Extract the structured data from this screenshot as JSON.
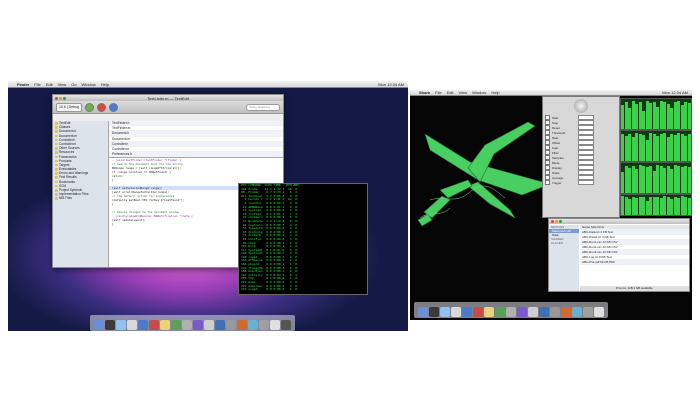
{
  "left_screen": {
    "menubar": {
      "apple": "",
      "items": [
        "Finder",
        "File",
        "Edit",
        "View",
        "Go",
        "Window",
        "Help"
      ],
      "clock": "Mon 12:34 AM"
    },
    "xcode_window": {
      "title": "TextLister.m — TextEdit",
      "toolbar": {
        "scheme": "10.6 | Debug",
        "buttons": [
          "Build and Go",
          "Tasks",
          "Info"
        ],
        "search_placeholder": "String Matching"
      },
      "sidebar_items": [
        "TextEdit",
        "Classes",
        "Document.h",
        "Document.m",
        "Controller.h",
        "Controller.m",
        "Other Sources",
        "Resources",
        "Frameworks",
        "Products",
        "Targets",
        "Executables",
        "Errors and Warnings",
        "Find Results",
        "Bookmarks",
        "SCM",
        "Project Symbols",
        "Implementation Files",
        "NIB Files"
      ],
      "file_list": [
        "TextFinder.h",
        "TextFinder.m",
        "Document.h",
        "Document.m",
        "Controller.h",
        "Controller.m",
        "Preferences.h",
        "Preferences.m"
      ],
      "editor_lines": [
        "- (void)textFinder:(TextFinder *)finder {",
        "    // Search the document text for the string",
        "    NSRange range = [self rangeOfString:str];",
        "    if (range.location == NSNotFound) {",
        "        return;",
        "    }",
        "",
        "    [self setSelectedRange:range];",
        "    [self scrollRangeToVisible:range];",
        "    // The default action for preferences",
        "    [defaults setBool:YES forKey:@\"LastFound\"];",
        "}",
        "",
        "// Resize changes to the document window",
        "- (void)windowDidResize:(NSNotification *)note {",
        "    [self updateLayout];",
        "}"
      ]
    },
    "terminal": {
      "lines": [
        "PID COMMAND  %CPU TIME   #TH #WQ",
        "142 Xcode    12.3 4:12.3  18  2",
        "98  Finder    0.7 0:23.1   8  1",
        "211 Terminal  3.2 0:05.8   4  0",
        "  0 kernel_t  5.1 9:41.0  62  0",
        "  1 launchd   0.0 0:02.4   3  0",
        " 12 mDNSResp  0.0 0:01.1   9  0",
        " 15 syslogd   0.0 0:00.8   4  0",
        " 18 configd   0.1 0:01.7   7  1",
        " 22 coreserv  0.0 0:00.9   5  0",
        " 31 WindowSe  1.4 1:12.6   6  0",
        " 44 loginwin  0.0 0:00.3   2  0",
        " 57 fseventd  0.0 0:00.5   4  0",
        " 63 distnote  0.0 0:00.2   2  0",
        " 75 diskarb   0.0 0:00.4   3  0",
        " 81 notifyd   0.0 0:00.6   3  0",
        " 90 ntpd      0.0 0:00.1   1  0",
        "103 Dock      0.3 0:03.2   4  0",
        "117 SystemUI  0.1 0:01.9   5  0",
        "125 Spotligh  0.0 0:00.7   3  0",
        "138 cupsd     0.0 0:00.2   2  0",
        "150 ATSServe  0.0 0:00.9   2  0",
        "166 pboard    0.0 0:00.1   1  0",
        "179 iTunesHe  0.0 0:00.3   2  0",
        "188 UserEven  0.0 0:00.4   2  0",
        "197 Activity  0.9 0:04.5   6  1",
        "205 top       2.1 0:00.6   1  0",
        "219 bash      0.0 0:00.0   1  0",
        "227 mdworker  0.0 0:00.2   3  0",
        "233 ocspd     0.0 0:00.0   1  0"
      ]
    },
    "dock_colors": [
      "#6b8fd6",
      "#3a3a3a",
      "#8fc2f0",
      "#d9d9d9",
      "#4a7ac8",
      "#c94a4a",
      "#e8d27a",
      "#5aa05a",
      "#b0b0b0",
      "#7a5ac8",
      "#cfcfcf",
      "#3e6fb0",
      "#999999",
      "#d06a2e",
      "#6ab0d0",
      "#a0a0a0",
      "#e0e0e0",
      "#555555"
    ]
  },
  "right_screen": {
    "menubar": {
      "items": [
        "Shark",
        "File",
        "Edit",
        "View",
        "Window",
        "Help"
      ],
      "clock": "Mon 12:34 AM"
    },
    "controls_panel": {
      "rows": [
        "Start",
        "Stop",
        "Reset",
        "Threshold",
        "Rate",
        "Offset",
        "Gain",
        "Filter",
        "Samples",
        "Mode",
        "Display",
        "Scale",
        "Average",
        "Trigger"
      ]
    },
    "finder_window": {
      "sidebar": [
        "DEVICES",
        "Macintosh HD",
        "iDisk",
        "SHARED",
        "PLACES"
      ],
      "rows": [
        "Name         Size   Kind",
        "ABC-Data.txt  4 KB  Text",
        "ABC-Data2.txt 4 KB  Text",
        "ABC-Run1.csv 12 KB  CSV",
        "ABC-Run2.csv 12 KB  CSV",
        "ABC-Run3.csv 12 KB  CSV",
        "ABC-Log.txt   8 KB  Text",
        "ABC-Plot.pdf 96 KB  PDF"
      ],
      "status": "8 items, 128.4 GB available"
    },
    "meters": [
      {
        "levels": [
          0.8,
          0.9,
          0.7,
          0.95,
          0.85,
          0.9,
          0.6,
          0.92,
          0.88,
          0.9,
          0.75,
          0.93,
          0.9,
          0.85,
          0.7,
          0.9,
          0.95,
          0.8,
          0.9,
          0.86
        ]
      },
      {
        "levels": [
          0.9,
          0.85,
          0.9,
          0.8,
          0.95,
          0.9,
          0.88,
          0.7,
          0.92,
          0.9,
          0.85,
          0.9,
          0.95,
          0.8,
          0.9,
          0.87,
          0.92,
          0.9,
          0.85,
          0.9
        ]
      },
      {
        "levels": [
          0.7,
          0.9,
          0.85,
          0.9,
          0.8,
          0.95,
          0.9,
          0.88,
          0.9,
          0.75,
          0.92,
          0.9,
          0.85,
          0.9,
          0.8,
          0.93,
          0.9,
          0.86,
          0.9,
          0.88
        ]
      },
      {
        "levels": [
          0.95,
          0.9,
          0.8,
          0.9,
          0.85,
          0.92,
          0.9,
          0.7,
          0.9,
          0.88,
          0.9,
          0.85,
          0.95,
          0.9,
          0.8,
          0.9,
          0.87,
          0.93,
          0.9,
          0.85
        ]
      }
    ],
    "dock_colors": [
      "#6b8fd6",
      "#3a3a3a",
      "#8fc2f0",
      "#d9d9d9",
      "#4a7ac8",
      "#c94a4a",
      "#e8d27a",
      "#5aa05a",
      "#b0b0b0",
      "#7a5ac8",
      "#cfcfcf",
      "#3e6fb0",
      "#999999",
      "#d06a2e",
      "#6ab0d0",
      "#a0a0a0",
      "#e0e0e0"
    ],
    "model_color": "#4fe06a"
  }
}
